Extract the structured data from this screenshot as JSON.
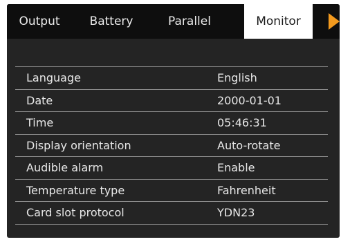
{
  "tabs": [
    {
      "label": "Output"
    },
    {
      "label": "Battery"
    },
    {
      "label": "Parallel"
    },
    {
      "label": "Monitor",
      "active": true
    }
  ],
  "next_icon": "triangle-right-icon",
  "settings": [
    {
      "label": "Language",
      "value": "English"
    },
    {
      "label": "Date",
      "value": "2000-01-01"
    },
    {
      "label": "Time",
      "value": "05:46:31"
    },
    {
      "label": "Display orientation",
      "value": "Auto-rotate"
    },
    {
      "label": "Audible alarm",
      "value": "Enable"
    },
    {
      "label": "Temperature type",
      "value": "Fahrenheit"
    },
    {
      "label": "Card slot protocol",
      "value": "YDN23"
    }
  ],
  "colors": {
    "screen_bg": "#242424",
    "tabbar_bg": "#0e0e0e",
    "active_tab_bg": "#ffffff",
    "accent": "#f39a1e",
    "divider": "#8c8c8c"
  }
}
